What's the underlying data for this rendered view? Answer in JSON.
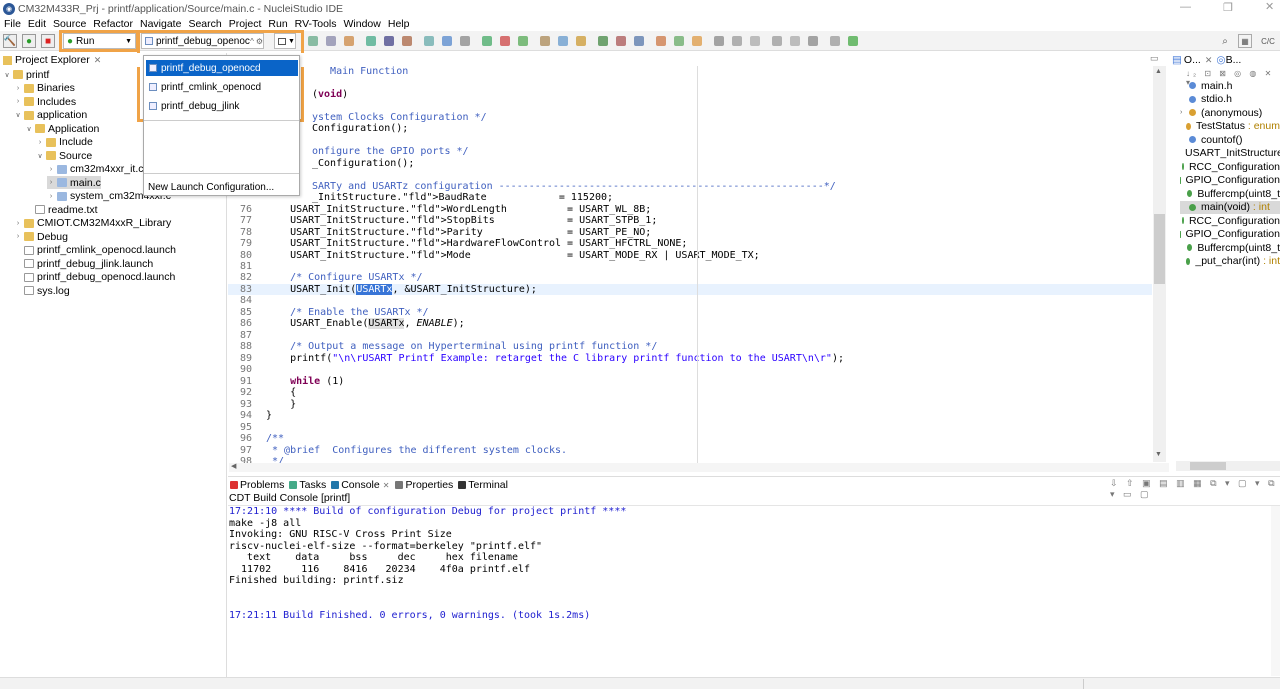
{
  "window": {
    "title": "CM32M433R_Prj - printf/application/Source/main.c - NucleiStudio IDE"
  },
  "menu": [
    "File",
    "Edit",
    "Source",
    "Refactor",
    "Navigate",
    "Search",
    "Project",
    "Run",
    "RV-Tools",
    "Window",
    "Help"
  ],
  "toolbar": {
    "mode_value": "Run",
    "launch_config_value": "printf_debug_openoc"
  },
  "dropdown": {
    "items": [
      "printf_debug_openocd",
      "printf_cmlink_openocd",
      "printf_debug_jlink"
    ],
    "new_config": "New Launch Configuration..."
  },
  "project_explorer": {
    "title": "Project Explorer",
    "items": [
      {
        "label": "printf",
        "level": 0,
        "tw": "∨",
        "icon": "folder"
      },
      {
        "label": "Binaries",
        "level": 1,
        "tw": "›",
        "icon": "folder"
      },
      {
        "label": "Includes",
        "level": 1,
        "tw": "›",
        "icon": "folder"
      },
      {
        "label": "application",
        "level": 1,
        "tw": "∨",
        "icon": "folder"
      },
      {
        "label": "Application",
        "level": 2,
        "tw": "∨",
        "icon": "folder"
      },
      {
        "label": "Include",
        "level": 3,
        "tw": "›",
        "icon": "folder"
      },
      {
        "label": "Source",
        "level": 3,
        "tw": "∨",
        "icon": "folder"
      },
      {
        "label": "cm32m4xxr_it.c",
        "level": 4,
        "tw": "›",
        "icon": "src"
      },
      {
        "label": "main.c",
        "level": 4,
        "tw": "›",
        "icon": "src",
        "selected": true
      },
      {
        "label": "system_cm32m4xxr.c",
        "level": 4,
        "tw": "›",
        "icon": "src"
      },
      {
        "label": "readme.txt",
        "level": 2,
        "tw": "",
        "icon": "file"
      },
      {
        "label": "CMIOT.CM32M4xxR_Library",
        "level": 1,
        "tw": "›",
        "icon": "folder"
      },
      {
        "label": "Debug",
        "level": 1,
        "tw": "›",
        "icon": "folder"
      },
      {
        "label": "printf_cmlink_openocd.launch",
        "level": 1,
        "tw": "",
        "icon": "file"
      },
      {
        "label": "printf_debug_jlink.launch",
        "level": 1,
        "tw": "",
        "icon": "file"
      },
      {
        "label": "printf_debug_openocd.launch",
        "level": 1,
        "tw": "",
        "icon": "file"
      },
      {
        "label": "sys.log",
        "level": 1,
        "tw": "",
        "icon": "file"
      }
    ]
  },
  "editor": {
    "lines": [
      {
        "n": "",
        "t": "   Main Function"
      },
      {
        "n": "",
        "t": ""
      },
      {
        "n": "",
        "t": "(void)"
      },
      {
        "n": "",
        "t": ""
      },
      {
        "n": "",
        "t": "ystem Clocks Configuration */"
      },
      {
        "n": "",
        "t": "Configuration();"
      },
      {
        "n": "",
        "t": ""
      },
      {
        "n": "",
        "t": "onfigure the GPIO ports */"
      },
      {
        "n": "",
        "t": "_Configuration();"
      },
      {
        "n": "",
        "t": ""
      },
      {
        "n": "",
        "t": "SARTy and USARTz configuration ------------------------------------------------------*/"
      },
      {
        "n": "",
        "t": "_InitStructure.BaudRate            = 115200;"
      },
      {
        "n": "76",
        "t": "    USART_InitStructure.WordLength          = USART_WL_8B;"
      },
      {
        "n": "77",
        "t": "    USART_InitStructure.StopBits            = USART_STPB_1;"
      },
      {
        "n": "78",
        "t": "    USART_InitStructure.Parity              = USART_PE_NO;"
      },
      {
        "n": "79",
        "t": "    USART_InitStructure.HardwareFlowControl = USART_HFCTRL_NONE;"
      },
      {
        "n": "80",
        "t": "    USART_InitStructure.Mode                = USART_MODE_RX | USART_MODE_TX;"
      },
      {
        "n": "81",
        "t": ""
      },
      {
        "n": "82",
        "t": "    /* Configure USARTx */"
      },
      {
        "n": "83",
        "t": "    USART_Init(USARTx, &USART_InitStructure);"
      },
      {
        "n": "84",
        "t": ""
      },
      {
        "n": "85",
        "t": "    /* Enable the USARTx */"
      },
      {
        "n": "86",
        "t": "    USART_Enable(USARTx, ENABLE);"
      },
      {
        "n": "87",
        "t": ""
      },
      {
        "n": "88",
        "t": "    /* Output a message on Hyperterminal using printf function */"
      },
      {
        "n": "89",
        "t": "    printf(\"\\n\\rUSART Printf Example: retarget the C library printf function to the USART\\n\\r\");"
      },
      {
        "n": "90",
        "t": ""
      },
      {
        "n": "91",
        "t": "    while (1)"
      },
      {
        "n": "92",
        "t": "    {"
      },
      {
        "n": "93",
        "t": "    }"
      },
      {
        "n": "94",
        "t": "}"
      },
      {
        "n": "95",
        "t": ""
      },
      {
        "n": "96",
        "t": "/**"
      },
      {
        "n": "97",
        "t": " * @brief  Configures the different system clocks."
      },
      {
        "n": "98",
        "t": " */"
      }
    ]
  },
  "outline": {
    "title": "O...",
    "title2": "B...",
    "items": [
      {
        "label": "main.h",
        "color": "#5b8bd6"
      },
      {
        "label": "stdio.h",
        "color": "#5b8bd6"
      },
      {
        "label": "(anonymous)",
        "color": "#d9a032"
      },
      {
        "label": "TestStatus : enum",
        "color": "#d9a032"
      },
      {
        "label": "countof()",
        "color": "#5b8bd6"
      },
      {
        "label": "USART_InitStructure",
        "color": "#4aa0c0"
      },
      {
        "label": "RCC_Configuration",
        "color": "#4aa04a"
      },
      {
        "label": "GPIO_Configuration",
        "color": "#4aa04a"
      },
      {
        "label": "Buffercmp(uint8_t",
        "color": "#4aa04a"
      },
      {
        "label": "main(void) : int",
        "color": "#4aa04a",
        "selected": true
      },
      {
        "label": "RCC_Configuration",
        "color": "#4aa04a"
      },
      {
        "label": "GPIO_Configuration",
        "color": "#4aa04a"
      },
      {
        "label": "Buffercmp(uint8_t",
        "color": "#4aa04a"
      },
      {
        "label": "_put_char(int) : int",
        "color": "#4aa04a"
      }
    ]
  },
  "bottom": {
    "tabs": [
      "Problems",
      "Tasks",
      "Console",
      "Properties",
      "Terminal"
    ],
    "console_title": "CDT Build Console [printf]",
    "lines": [
      {
        "t": "17:21:10 **** Build of configuration Debug for project printf ****",
        "blue": true
      },
      {
        "t": "make -j8 all",
        "blue": false
      },
      {
        "t": "Invoking: GNU RISC-V Cross Print Size",
        "blue": false
      },
      {
        "t": "riscv-nuclei-elf-size --format=berkeley \"printf.elf\"",
        "blue": false
      },
      {
        "t": "   text    data     bss     dec     hex filename",
        "blue": false
      },
      {
        "t": "  11702     116    8416   20234    4f0a printf.elf",
        "blue": false
      },
      {
        "t": "Finished building: printf.siz",
        "blue": false
      },
      {
        "t": "",
        "blue": false
      },
      {
        "t": "",
        "blue": false
      },
      {
        "t": "17:21:11 Build Finished. 0 errors, 0 warnings. (took 1s.2ms)",
        "blue": true
      }
    ]
  }
}
